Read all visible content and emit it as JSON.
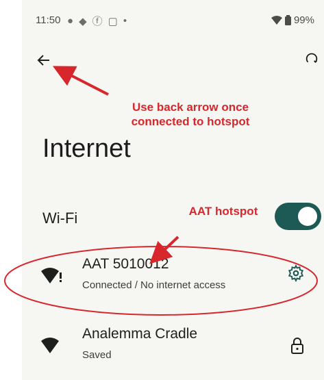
{
  "status_bar": {
    "time": "11:50",
    "battery": "99%"
  },
  "page": {
    "title": "Internet"
  },
  "wifi": {
    "label": "Wi-Fi",
    "enabled": true
  },
  "networks": [
    {
      "name": "AAT 5010012",
      "status": "Connected / No internet access",
      "icon": "wifi-alert-icon",
      "action_icon": "gear-icon"
    },
    {
      "name": "Analemma Cradle",
      "status": "Saved",
      "icon": "wifi-icon",
      "action_icon": "lock-icon"
    }
  ],
  "annotations": {
    "back_note": "Use back arrow once connected to hotspot",
    "hotspot_note": "AAT hotspot"
  },
  "colors": {
    "accent": "#1e5a55",
    "annotation": "#d7262c",
    "background": "#f6f7f3"
  }
}
